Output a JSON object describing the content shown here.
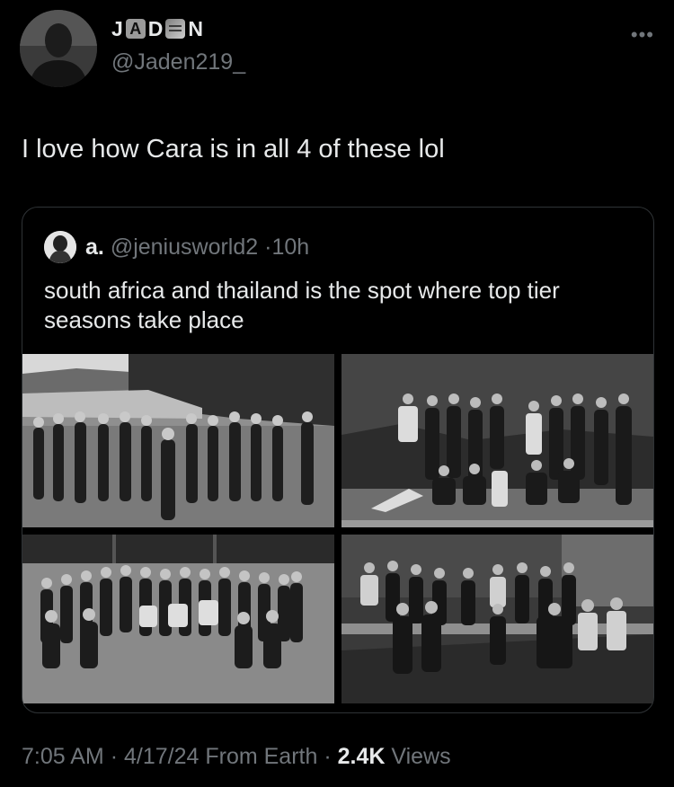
{
  "author": {
    "name_letters": [
      "J",
      "A",
      "D",
      "",
      "N"
    ],
    "handle": "@Jaden219_",
    "avatar_icon": "user-photo"
  },
  "more_icon_label": "•••",
  "tweet": {
    "text": "I love how Cara is in all 4 of these lol"
  },
  "quoted_tweet": {
    "name": "a.",
    "handle": "@jeniusworld2",
    "separator": "·",
    "time": "10h",
    "text": "south africa and thailand is the spot where top tier seasons take place",
    "images": [
      {
        "icon": "group-photo-south-africa-lake"
      },
      {
        "icon": "group-photo-studio-backdrop"
      },
      {
        "icon": "group-photo-field"
      },
      {
        "icon": "group-photo-stage-set"
      }
    ]
  },
  "meta": {
    "time": "7:05 AM",
    "sep1": "·",
    "date": "4/17/24",
    "source": "From Earth",
    "sep2": "·",
    "views_count": "2.4K",
    "views_label": "Views"
  },
  "colors": {
    "background": "#000000",
    "text": "#e7e9ea",
    "muted": "#71767b",
    "border": "#2f3336"
  }
}
